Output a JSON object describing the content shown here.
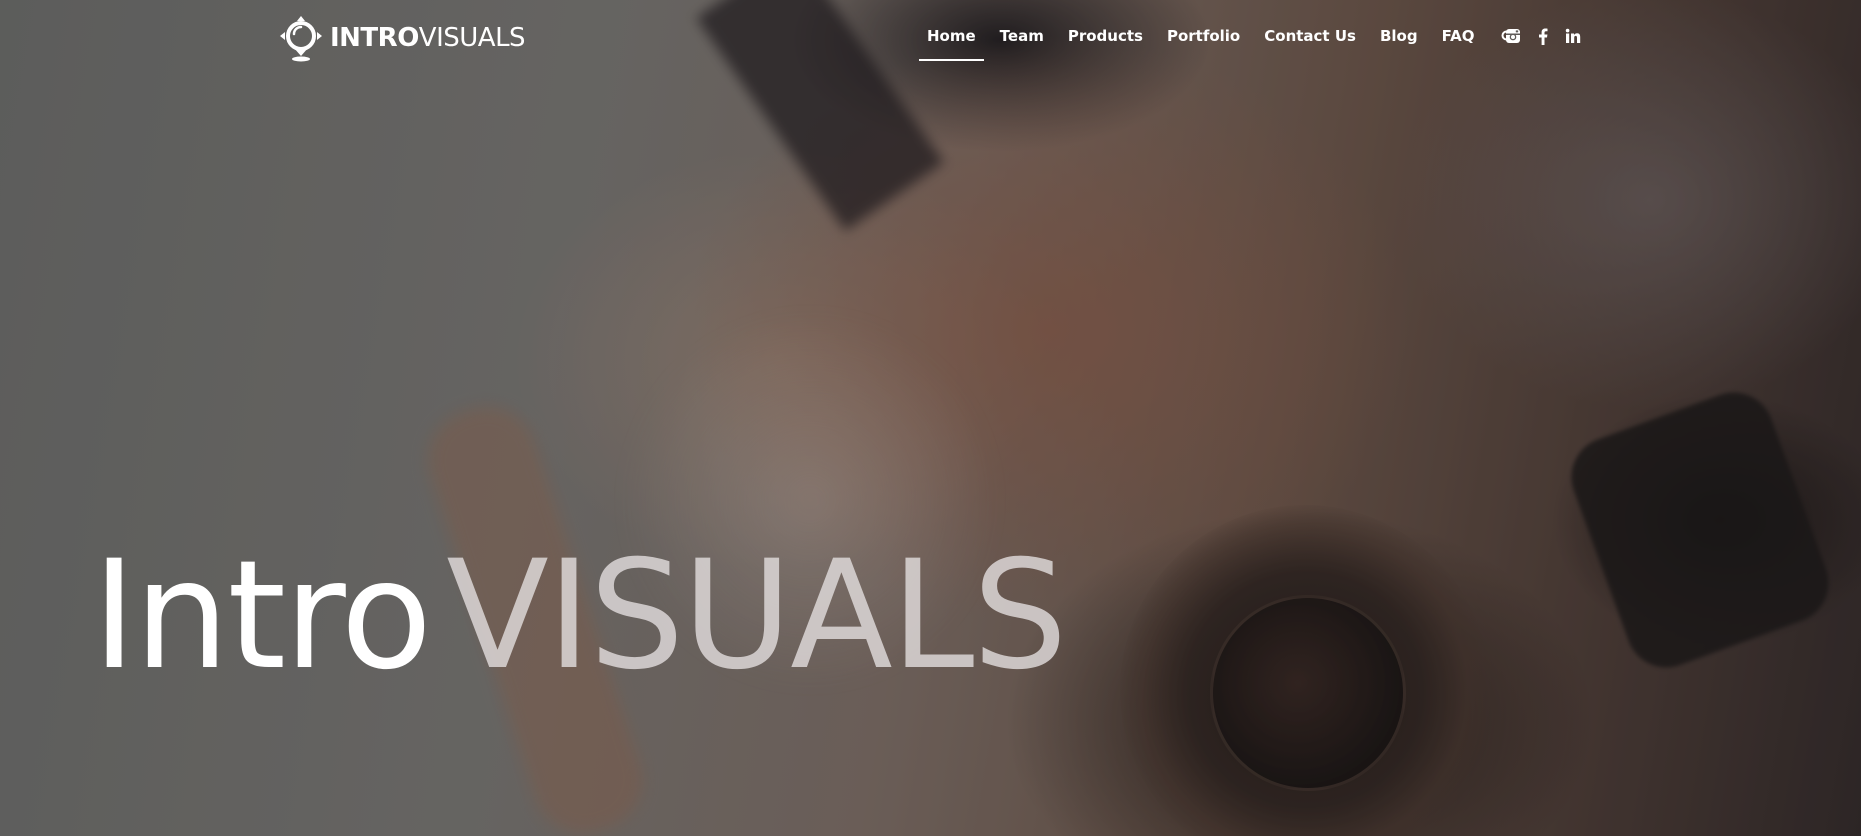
{
  "brand": {
    "name_bold": "INTRO",
    "name_light": "VISUALS",
    "logo_icon": "pin-lens-logo"
  },
  "nav": {
    "items": [
      {
        "label": "Home",
        "active": true
      },
      {
        "label": "Team",
        "active": false
      },
      {
        "label": "Products",
        "active": false
      },
      {
        "label": "Portfolio",
        "active": false
      },
      {
        "label": "Contact Us",
        "active": false
      },
      {
        "label": "Blog",
        "active": false
      },
      {
        "label": "FAQ",
        "active": false
      }
    ],
    "search_icon": "search-icon"
  },
  "social": {
    "icons": [
      "instagram-icon",
      "facebook-icon",
      "linkedin-icon"
    ]
  },
  "hero": {
    "title_part1": "Intro",
    "title_part2": "VISUALS"
  },
  "colors": {
    "text": "#ffffff",
    "title_secondary": "#e1dcdc"
  }
}
